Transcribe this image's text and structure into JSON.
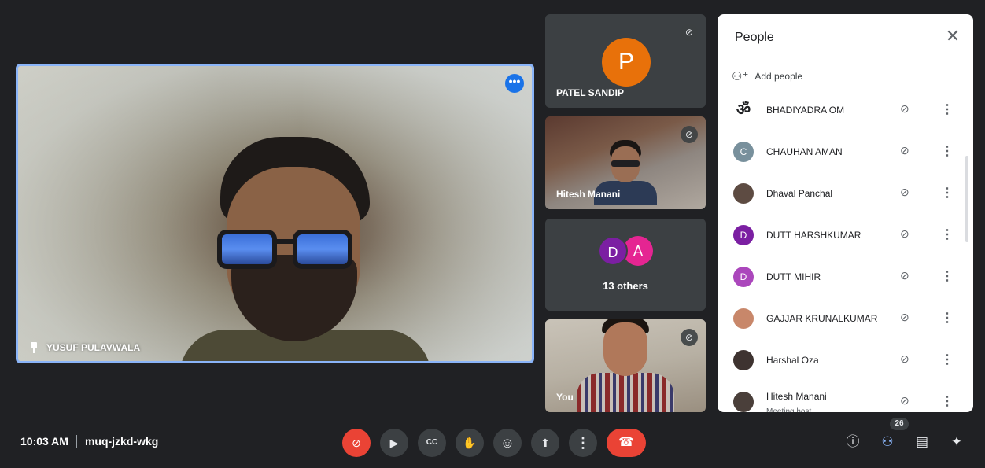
{
  "main_video": {
    "participant_name": "YUSUF PULAVWALA",
    "more_options_glyph": "•••",
    "pin_icon": "pin-icon"
  },
  "side_tiles": [
    {
      "name": "PATEL SANDIP",
      "avatar_letter": "P",
      "avatar_color": "#e8710a",
      "muted": true
    },
    {
      "name": "Hitesh Manani",
      "muted": true
    },
    {
      "name": "13 others",
      "avatars": [
        "D",
        "A"
      ]
    },
    {
      "name": "You",
      "muted": true
    }
  ],
  "people_panel": {
    "title": "People",
    "close_glyph": "✕",
    "add_people_label": "Add people",
    "participants": [
      {
        "name": "BHADIYADRA OM",
        "avatar": "ॐ",
        "avatar_bg": "#ffffff",
        "avatar_fg": "#202124"
      },
      {
        "name": "CHAUHAN AMAN",
        "avatar": "C",
        "avatar_bg": "#78909c",
        "avatar_fg": "#ffffff"
      },
      {
        "name": "Dhaval Panchal",
        "avatar": "",
        "avatar_bg": "#5d4b42",
        "avatar_fg": "#ffffff"
      },
      {
        "name": "DUTT HARSHKUMAR",
        "avatar": "D",
        "avatar_bg": "#7b1fa2",
        "avatar_fg": "#ffffff"
      },
      {
        "name": "DUTT MIHIR",
        "avatar": "D",
        "avatar_bg": "#ab47bc",
        "avatar_fg": "#ffffff"
      },
      {
        "name": "GAJJAR KRUNALKUMAR",
        "avatar": "",
        "avatar_bg": "#c8876a",
        "avatar_fg": "#ffffff"
      },
      {
        "name": "Harshal Oza",
        "avatar": "",
        "avatar_bg": "#3e3330",
        "avatar_fg": "#ffffff"
      },
      {
        "name": "Hitesh Manani",
        "sub": "Meeting host",
        "avatar": "",
        "avatar_bg": "#4a3f3a",
        "avatar_fg": "#ffffff"
      }
    ],
    "mic_off_glyph": "⊘",
    "more_glyph": "⋮"
  },
  "bottom_bar": {
    "time": "10:03 AM",
    "meeting_code": "muq-jzkd-wkg",
    "participant_count": "26",
    "controls": {
      "mic": "⊘",
      "camera": "▶",
      "captions": "CC",
      "raise_hand": "✋",
      "reactions": "☺",
      "present": "⬆",
      "more": "⋮",
      "end_call": "☎"
    },
    "right_controls": {
      "info": "ⓘ",
      "people": "⚇",
      "chat": "▤",
      "activities": "✦"
    }
  }
}
